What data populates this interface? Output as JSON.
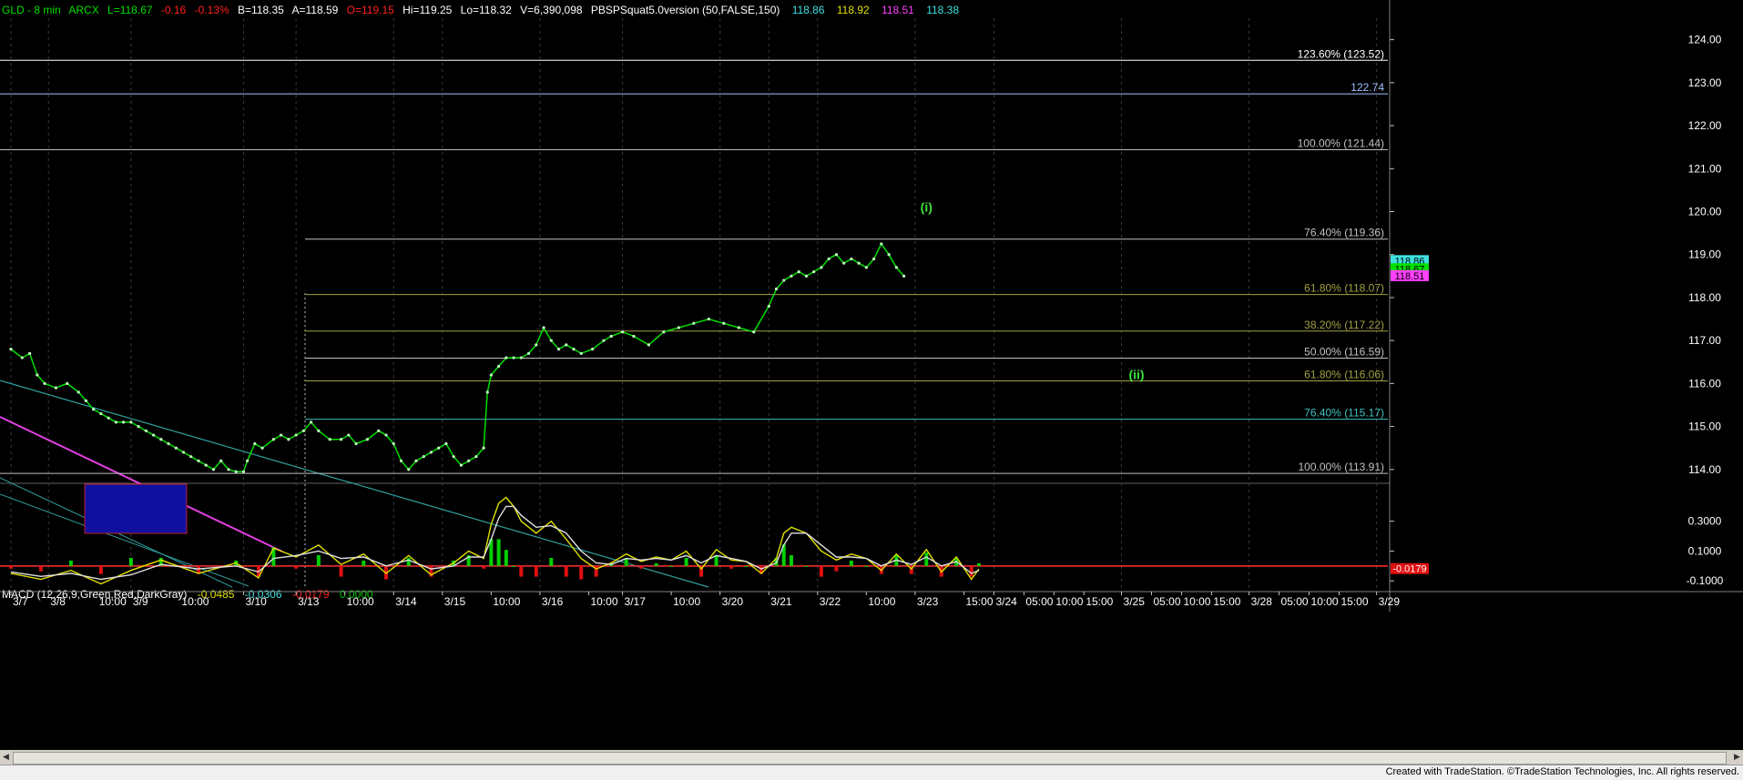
{
  "header": {
    "symbol": "GLD - 8 min",
    "exchange": "ARCX",
    "last": "L=118.67",
    "change": "-0.16",
    "change_pct": "-0.13%",
    "bid": "B=118.35",
    "ask": "A=118.59",
    "open": "O=119.15",
    "high": "Hi=119.25",
    "low": "Lo=118.32",
    "volume": "V=6,390,098",
    "indicator": "PBSPSquat5.0version (50,FALSE,150)",
    "ind_values": [
      "118.86",
      "118.92",
      "118.51",
      "118.38"
    ],
    "colors": {
      "green": "#00e000",
      "red": "#ff2020",
      "white": "#ffffff",
      "cyan": "#40e0e0",
      "yellow": "#e0e000",
      "magenta": "#ff40ff"
    }
  },
  "chart_data": [
    {
      "type": "line",
      "title": "GLD - 8 min",
      "ylim": [
        113.7,
        124.5
      ],
      "yticks": [
        "124.00",
        "123.00",
        "122.00",
        "121.00",
        "120.00",
        "119.00",
        "118.00",
        "117.00",
        "116.00",
        "115.00",
        "114.00"
      ],
      "ytick_values": [
        124,
        123,
        122,
        121,
        120,
        119,
        118,
        117,
        116,
        115,
        114
      ],
      "xlabels": [
        "3/7",
        "3/8",
        "10:00",
        "3/9",
        "10:00",
        "3/10",
        "3/13",
        "10:00",
        "3/14",
        "3/15",
        "10:00",
        "3/16",
        "10:00",
        "3/17",
        "10:00",
        "3/20",
        "3/21",
        "3/22",
        "10:00",
        "3/23",
        "15:00",
        "3/24",
        "05:00",
        "10:00",
        "15:00",
        "3/25",
        "05:00",
        "10:00",
        "15:00",
        "3/28",
        "05:00",
        "10:00",
        "15:00",
        "3/29"
      ],
      "xlabel_index": [
        0,
        10,
        23,
        32,
        45,
        62,
        76,
        89,
        102,
        115,
        128,
        141,
        154,
        163,
        176,
        189,
        202,
        215,
        228,
        241,
        254,
        262,
        270,
        278,
        286,
        296,
        304,
        312,
        320,
        330,
        338,
        346,
        354,
        364
      ],
      "series": [
        {
          "color": "#00e000",
          "x": [
            0,
            3,
            5,
            7,
            9,
            12,
            15,
            18,
            20,
            22,
            24,
            26,
            28,
            30,
            32,
            34,
            36,
            38,
            40,
            42,
            44,
            46,
            48,
            50,
            52,
            54,
            56,
            58,
            60,
            62,
            63,
            65,
            67,
            70,
            72,
            74,
            76,
            78,
            80,
            82,
            85,
            88,
            90,
            92,
            95,
            98,
            100,
            102,
            104,
            106,
            108,
            110,
            112,
            114,
            116,
            118,
            120,
            122,
            124,
            126,
            127,
            128,
            130,
            132,
            134,
            136,
            138,
            140,
            142,
            144,
            146,
            148,
            150,
            152,
            155,
            158,
            160,
            163,
            166,
            170,
            174,
            178,
            182,
            186,
            190,
            194,
            198,
            202,
            204,
            206,
            208,
            210,
            212,
            214,
            216,
            218,
            220,
            222,
            224,
            226,
            228,
            230,
            232,
            234,
            236,
            238
          ],
          "values": [
            116.8,
            116.6,
            116.7,
            116.2,
            116.0,
            115.9,
            116.0,
            115.8,
            115.6,
            115.4,
            115.3,
            115.2,
            115.1,
            115.1,
            115.1,
            115.0,
            114.9,
            114.8,
            114.7,
            114.6,
            114.5,
            114.4,
            114.3,
            114.2,
            114.1,
            114.0,
            114.2,
            114.0,
            113.95,
            113.95,
            114.2,
            114.6,
            114.5,
            114.7,
            114.8,
            114.7,
            114.8,
            114.9,
            115.1,
            114.9,
            114.7,
            114.7,
            114.8,
            114.6,
            114.7,
            114.9,
            114.8,
            114.6,
            114.2,
            114.0,
            114.2,
            114.3,
            114.4,
            114.5,
            114.6,
            114.3,
            114.1,
            114.2,
            114.3,
            114.5,
            115.8,
            116.2,
            116.4,
            116.6,
            116.6,
            116.6,
            116.7,
            116.9,
            117.3,
            117.0,
            116.8,
            116.9,
            116.8,
            116.7,
            116.8,
            117.0,
            117.1,
            117.2,
            117.1,
            116.9,
            117.2,
            117.3,
            117.4,
            117.5,
            117.4,
            117.3,
            117.2,
            117.8,
            118.2,
            118.4,
            118.5,
            118.6,
            118.5,
            118.6,
            118.7,
            118.9,
            119.0,
            118.8,
            118.9,
            118.8,
            118.7,
            118.9,
            119.25,
            119.0,
            118.7,
            118.5
          ]
        }
      ],
      "horizontal_levels": [
        {
          "label": "123.60% (123.52)",
          "value": 123.52,
          "color": "#ffffff"
        },
        {
          "label": "122.74",
          "value": 122.74,
          "color": "#a0c0ff"
        },
        {
          "label": "100.00% (121.44)",
          "value": 121.44,
          "color": "#c0c0c0"
        },
        {
          "label": "76.40% (119.36)",
          "value": 119.36,
          "color": "#c0c0c0"
        },
        {
          "label": "61.80% (118.07)",
          "value": 118.07,
          "color": "#a0a040"
        },
        {
          "label": "38.20% (117.22)",
          "value": 117.22,
          "color": "#a0a040"
        },
        {
          "label": "50.00% (116.59)",
          "value": 116.59,
          "color": "#c0c0c0"
        },
        {
          "label": "61.80% (116.06)",
          "value": 116.06,
          "color": "#a0a040"
        },
        {
          "label": "76.40% (115.17)",
          "value": 115.17,
          "color": "#40c0c0"
        },
        {
          "label": "100.00% (113.91)",
          "value": 113.91,
          "color": "#c0c0c0"
        }
      ],
      "annotations": [
        {
          "text": "(i)",
          "x": 244,
          "value": 120.0,
          "color": "#40e040"
        },
        {
          "text": "(ii)",
          "x": 300,
          "value": 116.1,
          "color": "#40e040"
        }
      ],
      "price_badges": [
        "118.86",
        "118.67",
        "118.51"
      ]
    },
    {
      "type": "line",
      "title": "MACD (12,26,9,Green,Red,DarkGray)",
      "label_values": [
        "-0.0485",
        "-0.0306",
        "-0.0179",
        "0.0000"
      ],
      "ylim": [
        -0.16,
        0.5
      ],
      "yticks": [
        "0.3000",
        "0.1000",
        "-0.1000"
      ],
      "ytick_values": [
        0.3,
        0.1,
        -0.1
      ],
      "last_badge": "-0.0179",
      "series": [
        {
          "name": "MACD",
          "color": "#e0e000",
          "x": [
            0,
            8,
            16,
            24,
            32,
            40,
            50,
            60,
            66,
            70,
            76,
            82,
            88,
            94,
            100,
            106,
            112,
            118,
            122,
            126,
            128,
            130,
            132,
            134,
            136,
            140,
            144,
            148,
            152,
            156,
            160,
            164,
            168,
            172,
            176,
            180,
            184,
            188,
            192,
            196,
            200,
            204,
            206,
            208,
            212,
            216,
            220,
            224,
            228,
            232,
            236,
            240,
            244,
            248,
            252,
            256,
            258
          ],
          "values": [
            -0.05,
            -0.09,
            -0.03,
            -0.12,
            -0.03,
            0.04,
            -0.05,
            0.02,
            -0.08,
            0.12,
            0.06,
            0.14,
            0.01,
            0.08,
            -0.05,
            0.07,
            -0.06,
            0.02,
            0.1,
            0.05,
            0.28,
            0.42,
            0.46,
            0.4,
            0.3,
            0.22,
            0.3,
            0.18,
            0.05,
            -0.02,
            0.02,
            0.08,
            0.03,
            0.06,
            0.04,
            0.1,
            -0.02,
            0.11,
            0.04,
            0.03,
            -0.05,
            0.05,
            0.22,
            0.26,
            0.22,
            0.1,
            0.04,
            0.08,
            0.05,
            -0.03,
            0.08,
            -0.02,
            0.11,
            -0.04,
            0.06,
            -0.09,
            -0.02
          ]
        },
        {
          "name": "Signal",
          "color": "#e0e0e0",
          "x": [
            0,
            8,
            16,
            24,
            32,
            40,
            50,
            60,
            66,
            70,
            76,
            82,
            88,
            94,
            100,
            106,
            112,
            118,
            122,
            126,
            128,
            130,
            132,
            134,
            136,
            140,
            144,
            148,
            152,
            156,
            160,
            164,
            168,
            172,
            176,
            180,
            184,
            188,
            192,
            196,
            200,
            204,
            206,
            208,
            212,
            216,
            220,
            224,
            228,
            232,
            236,
            240,
            244,
            248,
            252,
            256,
            258
          ],
          "values": [
            -0.04,
            -0.07,
            -0.05,
            -0.09,
            -0.06,
            0.01,
            -0.02,
            0.0,
            -0.04,
            0.05,
            0.07,
            0.1,
            0.05,
            0.06,
            0.0,
            0.04,
            -0.02,
            0.0,
            0.06,
            0.06,
            0.18,
            0.32,
            0.4,
            0.4,
            0.34,
            0.26,
            0.27,
            0.22,
            0.1,
            0.02,
            0.01,
            0.05,
            0.04,
            0.05,
            0.04,
            0.07,
            0.02,
            0.07,
            0.05,
            0.03,
            -0.02,
            0.02,
            0.14,
            0.22,
            0.22,
            0.14,
            0.06,
            0.06,
            0.05,
            0.0,
            0.04,
            0.01,
            0.06,
            0.0,
            0.03,
            -0.05,
            -0.03
          ]
        }
      ]
    }
  ],
  "footer": {
    "credit": "Created with TradeStation. ©TradeStation Technologies, Inc. All rights reserved."
  }
}
